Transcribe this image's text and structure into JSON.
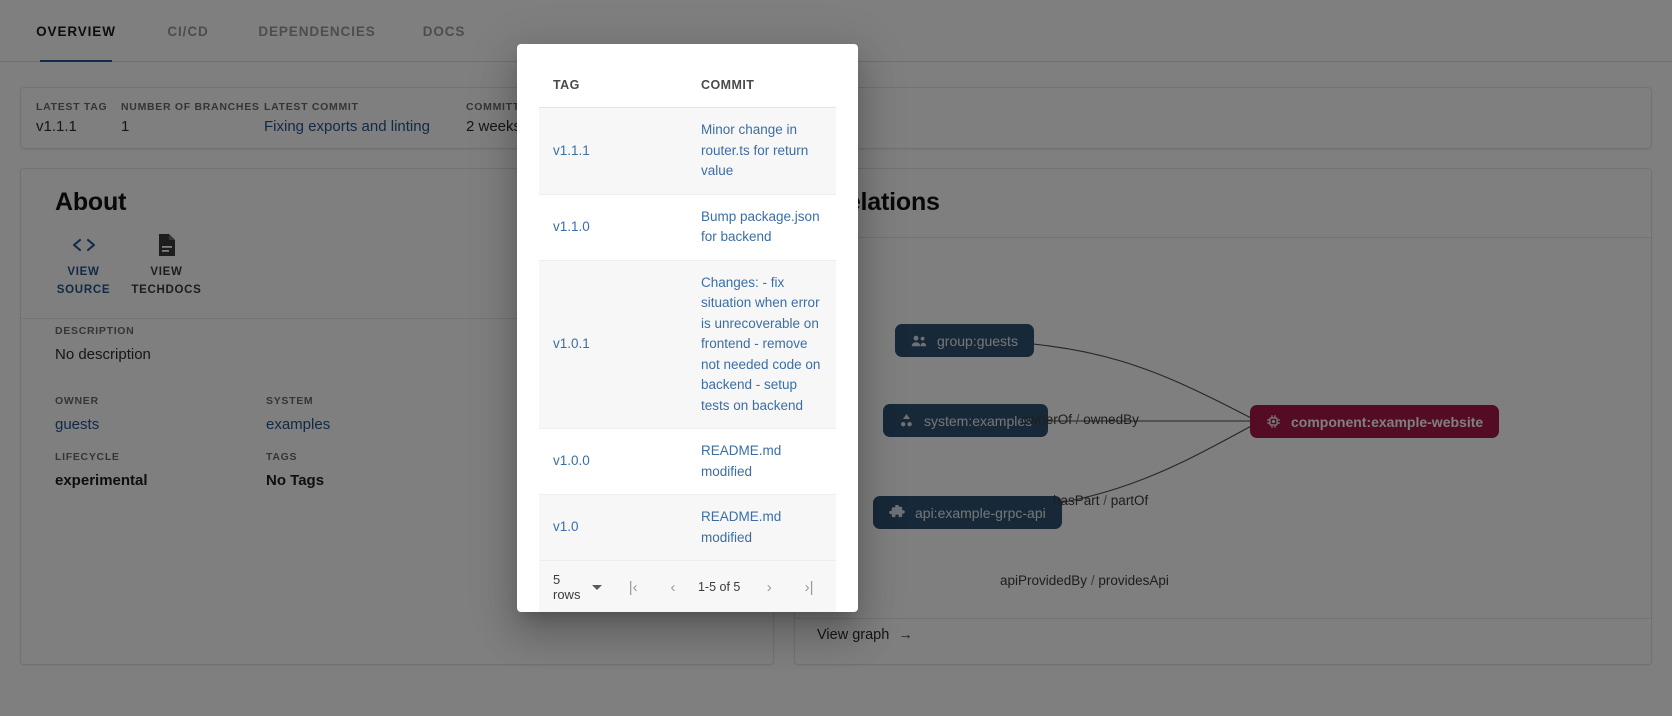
{
  "tabs": [
    {
      "label": "OVERVIEW",
      "active": true
    },
    {
      "label": "CI/CD",
      "active": false
    },
    {
      "label": "DEPENDENCIES",
      "active": false
    },
    {
      "label": "DOCS",
      "active": false
    }
  ],
  "summary": [
    {
      "label": "LATEST TAG",
      "value": "v1.1.1",
      "link": false
    },
    {
      "label": "NUMBER OF BRANCHES",
      "value": "1",
      "link": false
    },
    {
      "label": "LATEST COMMIT",
      "value": "Fixing exports and linting",
      "link": true
    },
    {
      "label": "COMMITTED",
      "value": "2 weeks",
      "link": false
    }
  ],
  "about": {
    "title": "About",
    "actions": [
      {
        "icon": "code-icon",
        "caption": "VIEW SOURCE"
      },
      {
        "icon": "document-icon",
        "caption": "VIEW TECHDOCS"
      }
    ],
    "fields": {
      "description_label": "DESCRIPTION",
      "description_value": "No description",
      "owner_label": "OWNER",
      "owner_value": "guests",
      "system_label": "SYSTEM",
      "system_value": "examples",
      "lifecycle_label": "LIFECYCLE",
      "lifecycle_value": "experimental",
      "tags_label": "TAGS",
      "tags_value": "No Tags"
    }
  },
  "relations": {
    "title": "Relations",
    "view_graph": "View graph",
    "arrow": "→",
    "nodes": [
      {
        "id": "group-guests",
        "label": "group:guests",
        "icon": "group-icon",
        "focus": false
      },
      {
        "id": "system-examples",
        "label": "system:examples",
        "icon": "system-icon",
        "focus": false
      },
      {
        "id": "api-grpc",
        "label": "api:example-grpc-api",
        "icon": "puzzle-icon",
        "focus": false
      },
      {
        "id": "component-site",
        "label": "component:example-website",
        "icon": "chip-icon",
        "focus": true
      }
    ],
    "edges": [
      {
        "forward": "ownerOf",
        "reverse": "ownedBy"
      },
      {
        "forward": "hasPart",
        "reverse": "partOf"
      },
      {
        "forward": "apiProvidedBy",
        "reverse": "providesApi"
      }
    ]
  },
  "modal": {
    "columns": [
      "TAG",
      "COMMIT"
    ],
    "rows": [
      {
        "tag": "v1.1.1",
        "commit": "Minor change in router.ts for return value"
      },
      {
        "tag": "v1.1.0",
        "commit": "Bump package.json for backend"
      },
      {
        "tag": "v1.0.1",
        "commit": "Changes: - fix situation when error is unrecoverable on frontend - remove not needed code on backend - setup tests on backend"
      },
      {
        "tag": "v1.0.0",
        "commit": "README.md modified"
      },
      {
        "tag": "v1.0",
        "commit": "README.md modified"
      }
    ],
    "pagination": {
      "rows_per_page": "5 rows",
      "range": "1-5 of 5",
      "first": "|‹",
      "prev": "‹",
      "next": "›",
      "last": "›|"
    }
  },
  "colors": {
    "accent": "#2b5797",
    "link": "#24548f",
    "node": "#2f5272",
    "node_focus": "#a8194a"
  }
}
